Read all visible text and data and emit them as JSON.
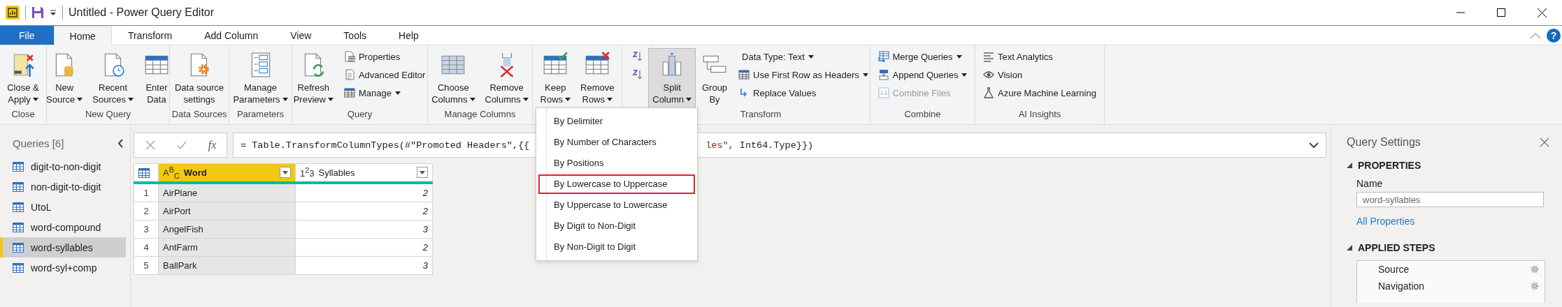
{
  "window": {
    "title": "Untitled - Power Query Editor"
  },
  "tabs": [
    {
      "label": "File",
      "kind": "file",
      "selected": false
    },
    {
      "label": "Home",
      "kind": "tab",
      "selected": true
    },
    {
      "label": "Transform",
      "kind": "tab",
      "selected": false
    },
    {
      "label": "Add Column",
      "kind": "tab",
      "selected": false
    },
    {
      "label": "View",
      "kind": "tab",
      "selected": false
    },
    {
      "label": "Tools",
      "kind": "tab",
      "selected": false
    },
    {
      "label": "Help",
      "kind": "tab",
      "selected": false
    }
  ],
  "help": "?",
  "ribbon": {
    "groups": [
      {
        "label": "Close",
        "items": [
          {
            "kind": "large",
            "lines": [
              "Close &",
              "Apply"
            ],
            "dropdown": true,
            "pressed": false
          }
        ]
      },
      {
        "label": "New Query",
        "items": [
          {
            "kind": "large",
            "lines": [
              "New",
              "Source"
            ],
            "dropdown": true,
            "pressed": false
          },
          {
            "kind": "large",
            "lines": [
              "Recent",
              "Sources"
            ],
            "dropdown": true,
            "pressed": false
          },
          {
            "kind": "large",
            "lines": [
              "Enter",
              "Data"
            ],
            "dropdown": false,
            "pressed": false
          }
        ]
      },
      {
        "label": "Data Sources",
        "items": [
          {
            "kind": "large",
            "lines": [
              "Data source",
              "settings"
            ],
            "dropdown": false,
            "pressed": false
          }
        ]
      },
      {
        "label": "Parameters",
        "items": [
          {
            "kind": "large",
            "lines": [
              "Manage",
              "Parameters"
            ],
            "dropdown": true,
            "pressed": false
          }
        ]
      },
      {
        "label": "Query",
        "items": [
          {
            "kind": "large",
            "lines": [
              "Refresh",
              "Preview"
            ],
            "dropdown": true,
            "pressed": false
          },
          {
            "kind": "stack",
            "items": [
              {
                "kind": "small",
                "label": "Properties",
                "dropdown": false,
                "disabled": false
              },
              {
                "kind": "small",
                "label": "Advanced Editor",
                "dropdown": false,
                "disabled": false
              },
              {
                "kind": "small",
                "label": "Manage",
                "dropdown": true,
                "disabled": false
              }
            ]
          }
        ]
      },
      {
        "label": "Manage Columns",
        "items": [
          {
            "kind": "large",
            "lines": [
              "Choose",
              "Columns"
            ],
            "dropdown": true,
            "pressed": false
          },
          {
            "kind": "large",
            "lines": [
              "Remove",
              "Columns"
            ],
            "dropdown": true,
            "pressed": false
          }
        ]
      },
      {
        "items": [
          {
            "kind": "large",
            "lines": [
              "Keep",
              "Rows"
            ],
            "dropdown": true,
            "pressed": false
          },
          {
            "kind": "large",
            "lines": [
              "Remove",
              "Rows"
            ],
            "dropdown": true,
            "pressed": false
          }
        ]
      },
      {
        "items": [
          {
            "kind": "stack",
            "items": [
              {
                "kind": "icon"
              },
              {
                "kind": "icon"
              }
            ]
          }
        ]
      },
      {
        "label": "Transform",
        "items": [
          {
            "kind": "large",
            "lines": [
              "Split",
              "Column"
            ],
            "dropdown": true,
            "pressed": true
          },
          {
            "kind": "large",
            "lines": [
              "Group",
              "By"
            ],
            "dropdown": false,
            "pressed": false
          },
          {
            "kind": "stack",
            "items": [
              {
                "kind": "small",
                "label": "Data Type: Text",
                "dropdown": true,
                "disabled": false
              },
              {
                "kind": "small",
                "label": "Use First Row as Headers",
                "dropdown": true,
                "disabled": false
              },
              {
                "kind": "small",
                "label": "Replace Values",
                "dropdown": false,
                "disabled": false
              }
            ]
          }
        ]
      },
      {
        "label": "Combine",
        "items": [
          {
            "kind": "stack",
            "items": [
              {
                "kind": "small",
                "label": "Merge Queries",
                "dropdown": true,
                "disabled": false
              },
              {
                "kind": "small",
                "label": "Append Queries",
                "dropdown": true,
                "disabled": false
              },
              {
                "kind": "small",
                "label": "Combine Files",
                "dropdown": false,
                "disabled": true
              }
            ]
          }
        ]
      },
      {
        "label": "AI Insights",
        "items": [
          {
            "kind": "stack",
            "items": [
              {
                "kind": "small",
                "label": "Text Analytics",
                "dropdown": false,
                "disabled": false
              },
              {
                "kind": "small",
                "label": "Vision",
                "dropdown": false,
                "disabled": false
              },
              {
                "kind": "small",
                "label": "Azure Machine Learning",
                "dropdown": false,
                "disabled": false
              }
            ]
          }
        ]
      }
    ]
  },
  "queries_pane": {
    "title": "Queries [6]",
    "items": [
      {
        "label": "digit-to-non-digit",
        "selected": false
      },
      {
        "label": "non-digit-to-digit",
        "selected": false
      },
      {
        "label": "UtoL",
        "selected": false
      },
      {
        "label": "word-compound",
        "selected": false
      },
      {
        "label": "word-syllables",
        "selected": true
      },
      {
        "label": "word-syl+comp",
        "selected": false
      }
    ]
  },
  "formula_bar": {
    "fx": "fx",
    "head": "= Table.TransformColumnTypes(#\"Promoted Headers\",{{",
    "tail": [
      {
        "text": "les\"",
        "kind": "string"
      },
      {
        "text": ", Int64.Type}})",
        "kind": "code"
      }
    ]
  },
  "table": {
    "columns": [
      {
        "type_label": "A$^{B}$$_{C}$",
        "name": "Word",
        "selected": true
      },
      {
        "type_label": "1$^{2}$3",
        "name": "Syllables",
        "selected": false
      }
    ],
    "rows": [
      {
        "index": "1",
        "cells": [
          "AirPlane",
          "2"
        ]
      },
      {
        "index": "2",
        "cells": [
          "AirPort",
          "2"
        ]
      },
      {
        "index": "3",
        "cells": [
          "AngelFish",
          "3"
        ]
      },
      {
        "index": "4",
        "cells": [
          "AntFarm",
          "2"
        ]
      },
      {
        "index": "5",
        "cells": [
          "BallPark",
          "3"
        ]
      }
    ]
  },
  "split_menu": {
    "items": [
      {
        "label": "By Delimiter",
        "highlighted": false
      },
      {
        "label": "By Number of Characters",
        "highlighted": false
      },
      {
        "label": "By Positions",
        "highlighted": false
      },
      {
        "label": "By Lowercase to Uppercase",
        "highlighted": true
      },
      {
        "label": "By Uppercase to Lowercase",
        "highlighted": false
      },
      {
        "label": "By Digit to Non-Digit",
        "highlighted": false
      },
      {
        "label": "By Non-Digit to Digit",
        "highlighted": false
      }
    ]
  },
  "query_settings": {
    "title": "Query Settings",
    "properties_heading": "PROPERTIES",
    "name_label": "Name",
    "name_value": "word-syllables",
    "all_properties": "All Properties",
    "steps_heading": "APPLIED STEPS",
    "steps": [
      {
        "label": "Source"
      },
      {
        "label": "Navigation"
      }
    ]
  }
}
